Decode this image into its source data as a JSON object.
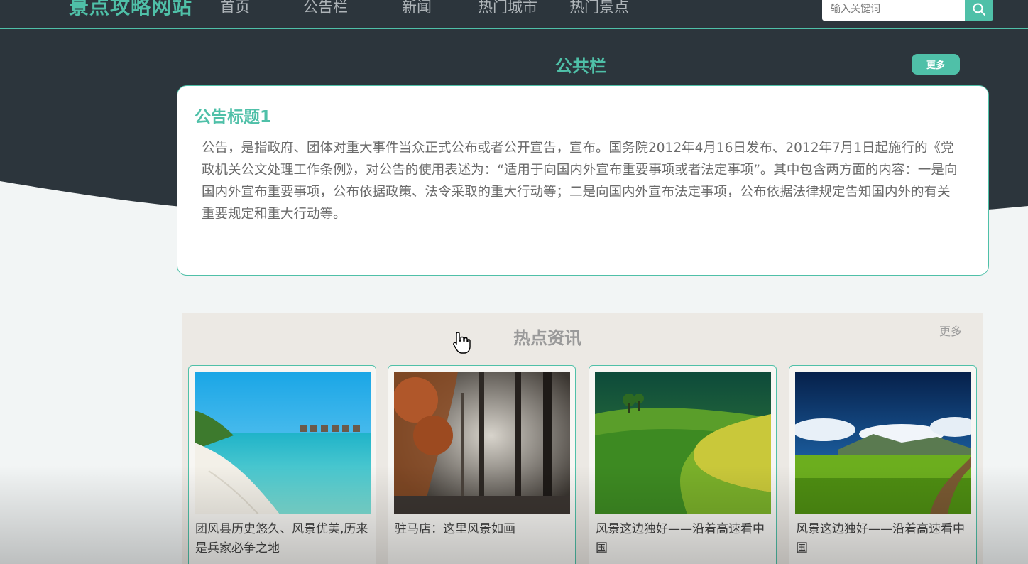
{
  "header": {
    "site_title": "景点攻略网站",
    "nav": [
      {
        "label": "首页"
      },
      {
        "label": "公告栏"
      },
      {
        "label": "新闻"
      },
      {
        "label": "热门城市"
      },
      {
        "label": "热门景点"
      }
    ],
    "search": {
      "placeholder": "输入关键词",
      "icon": "search-icon"
    }
  },
  "public_board": {
    "title": "公共栏",
    "more_label": "更多",
    "notice": {
      "title": "公告标题1",
      "body": "公告，是指政府、团体对重大事件当众正式公布或者公开宣告，宣布。国务院2012年4月16日发布、2012年7月1日起施行的《党政机关公文处理工作条例》，对公告的使用表述为：“适用于向国内外宣布重要事项或者法定事项”。其中包含两方面的内容：一是向国内外宣布重要事项，公布依据政策、法令采取的重大行动等；二是向国内外宣布法定事项，公布依据法律规定告知国内外的有关重要规定和重大行动等。"
    }
  },
  "hot_news": {
    "title": "热点资讯",
    "more_label": "更多",
    "items": [
      {
        "caption": "团风县历史悠久、风景优美,历来是兵家必争之地",
        "image": "tropical-beach"
      },
      {
        "caption": "驻马店：这里风景如画",
        "image": "misty-autumn-forest"
      },
      {
        "caption": "风景这边独好——沿着高速看中国",
        "image": "green-rolling-hills"
      },
      {
        "caption": "风景这边独好——沿着高速看中国",
        "image": "grassland-dirt-road"
      }
    ]
  },
  "colors": {
    "accent": "#4fc0a8",
    "header_bg": "#2c353c",
    "page_bg": "#f2f5f5",
    "news_panel_bg": "#ece9e4"
  }
}
